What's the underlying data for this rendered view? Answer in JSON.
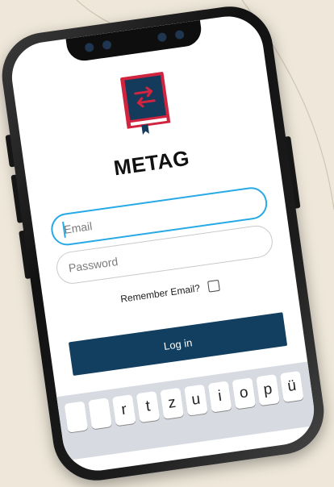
{
  "app": {
    "title": "METAG",
    "brand_color": "#d0243f",
    "brand_dark": "#143a5c"
  },
  "login": {
    "email_placeholder": "Email",
    "password_placeholder": "Password",
    "remember_label": "Remember Email?",
    "remember_checked": false,
    "login_label": "Log in"
  },
  "keyboard": {
    "keys": [
      "",
      "",
      "r",
      "t",
      "z",
      "u",
      "i",
      "o",
      "p",
      "ü"
    ]
  },
  "colors": {
    "focus": "#27a9e6",
    "button": "#123f60"
  }
}
